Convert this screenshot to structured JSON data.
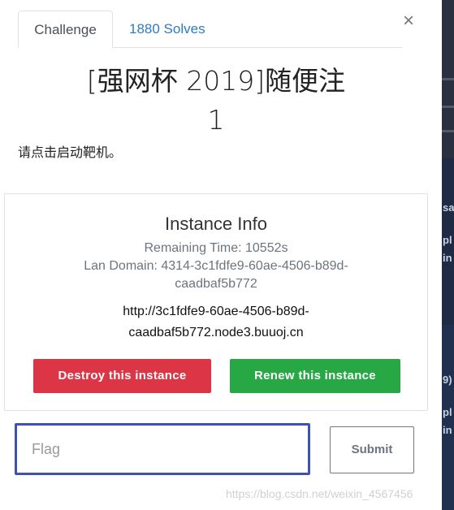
{
  "tabs": [
    {
      "label": "Challenge"
    },
    {
      "label": "1880 Solves"
    }
  ],
  "close_glyph": "×",
  "challenge": {
    "title_line1": "[强网杯 2019]随便注",
    "title_line2": "1",
    "description": "请点击启动靶机。"
  },
  "instance": {
    "heading": "Instance Info",
    "remaining_time": "Remaining Time: 10552s",
    "lan_domain_line1": "Lan Domain: 4314-3c1fdfe9-60ae-4506-b89d-",
    "lan_domain_line2": "caadbaf5b772",
    "url_line1": "http://3c1fdfe9-60ae-4506-b89d-",
    "url_line2": "caadbaf5b772.node3.buuoj.cn",
    "destroy_label": "Destroy this instance",
    "renew_label": "Renew this instance"
  },
  "flag_form": {
    "placeholder": "Flag",
    "submit_label": "Submit"
  },
  "watermark": "https://blog.csdn.net/weixin_4567456",
  "background_fragments": [
    "sa",
    "pl",
    "in",
    "9)",
    "pl",
    "in"
  ],
  "colors": {
    "link": "#2e7bc4",
    "destroy": "#dc3545",
    "renew": "#28a745",
    "focus_border": "#3f51b5"
  }
}
